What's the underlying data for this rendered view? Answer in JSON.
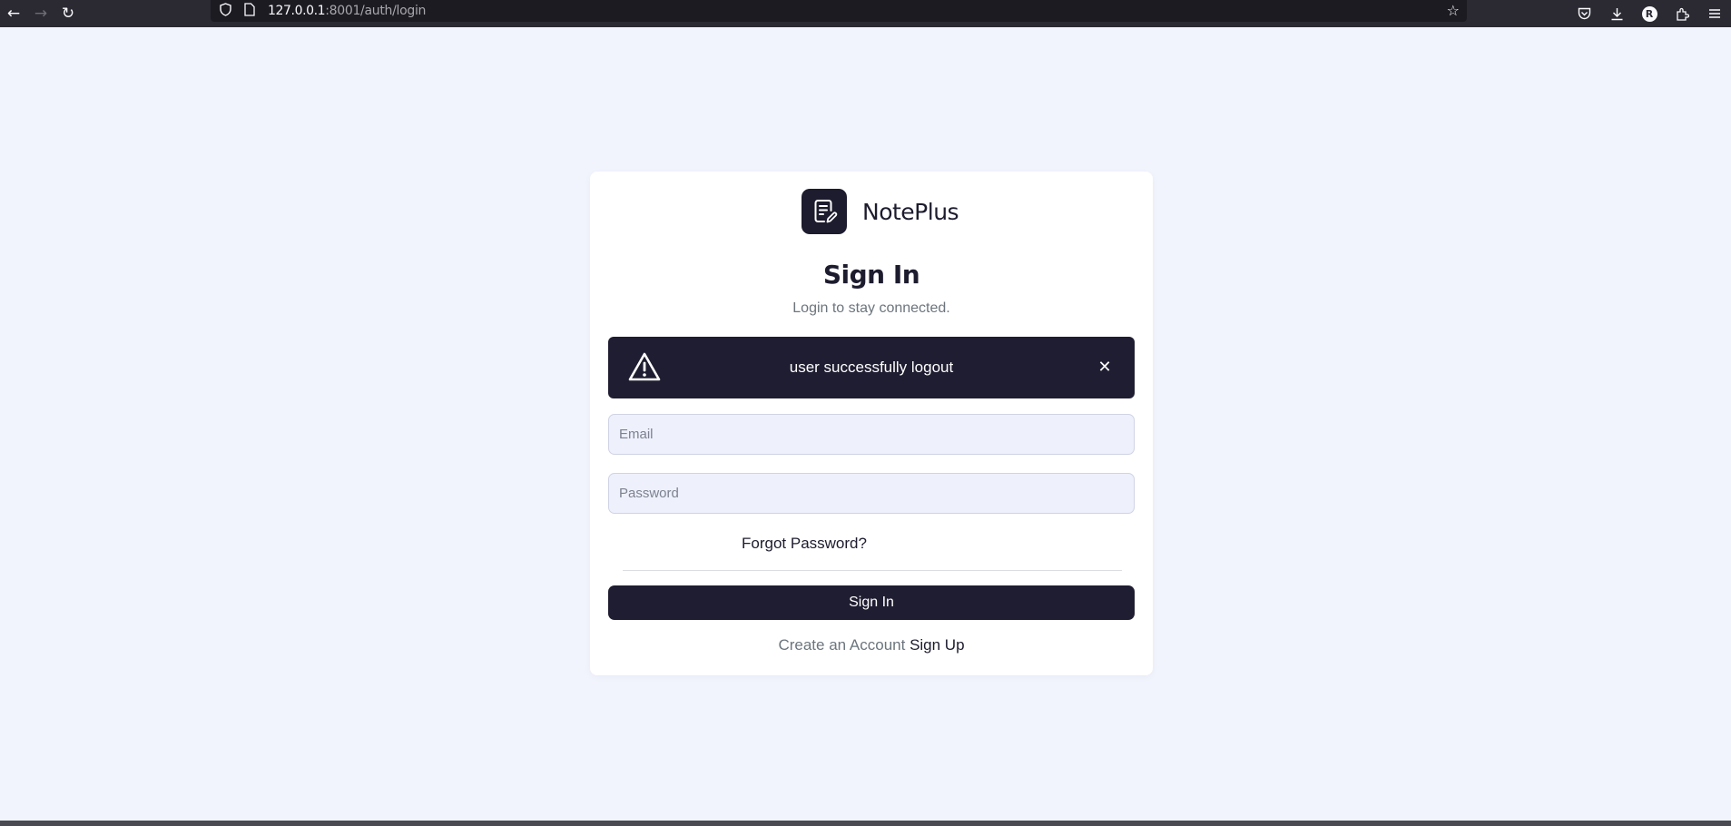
{
  "browser": {
    "back_icon": "←",
    "forward_icon": "→",
    "reload_icon": "↻",
    "url_host": "127.0.0.1",
    "url_path": ":8001/auth/login",
    "avatar_initial": "R"
  },
  "brand": {
    "name": "NotePlus",
    "logo_icon": "note-edit-icon"
  },
  "login": {
    "title": "Sign In",
    "subtitle": "Login to stay connected.",
    "alert_message": "user successfully logout",
    "alert_close": "✕",
    "email_placeholder": "Email",
    "password_placeholder": "Password",
    "forgot_label": "Forgot Password?",
    "submit_label": "Sign In",
    "create_account_text": "Create an Account",
    "signup_label": "Sign Up"
  },
  "colors": {
    "background": "#f1f4fd",
    "primary_dark": "#1f1d31",
    "muted_text": "#6c757d"
  }
}
